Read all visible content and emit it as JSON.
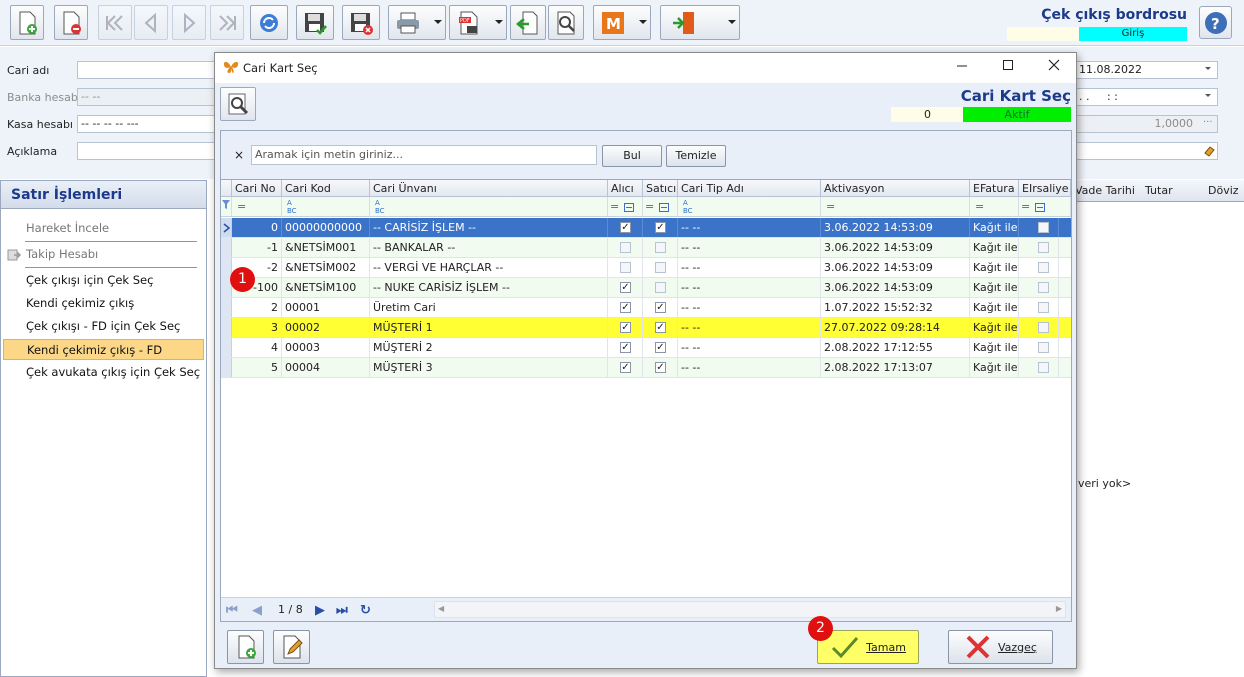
{
  "window": {
    "title": "Çek çıkış bordrosu",
    "status": "Giriş"
  },
  "form": {
    "cari_adi_label": "Cari adı",
    "banka_label": "Banka hesabı",
    "banka_value": "-- --",
    "kasa_label": "Kasa hesabı",
    "kasa_value": "-- -- -- -- ---",
    "aciklama_label": "Açıklama",
    "date_value": "11.08.2022",
    "time_value": ". .     : :",
    "rate_value": "1,0000"
  },
  "sidebar": {
    "title": "Satır İşlemleri",
    "items": [
      {
        "label": "Hareket İncele",
        "state": "disabled"
      },
      {
        "label": "Takip Hesabı",
        "state": "disabled"
      },
      {
        "label": "Çek çıkışı için Çek Seç",
        "state": "normal"
      },
      {
        "label": "Kendi çekimiz çıkış",
        "state": "normal"
      },
      {
        "label": "Çek çıkışı - FD için Çek Seç",
        "state": "normal"
      },
      {
        "label": "Kendi çekimiz çıkış - FD",
        "state": "selected"
      },
      {
        "label": "Çek avukata çıkış için Çek Seç",
        "state": "normal"
      }
    ]
  },
  "right_grid": {
    "columns": [
      "Vade Tarihi",
      "Tutar",
      "Döviz"
    ],
    "empty_text": "veri yok>"
  },
  "dialog": {
    "title": "Cari Kart Seç",
    "header_title": "Cari Kart Seç",
    "count": "0",
    "status": "Aktif",
    "search": {
      "clear": "×",
      "placeholder": "Aramak için metin giriniz...",
      "find_label": "Bul",
      "clear_label": "Temizle"
    },
    "columns": [
      "Cari No",
      "Cari Kod",
      "Cari Ünvanı",
      "Alıcı",
      "Satıcı",
      "Cari Tip Adı",
      "Aktivasyon",
      "EFatura",
      "EIrsaliye"
    ],
    "rows": [
      {
        "no": "0",
        "kod": "00000000000",
        "unvan": "-- CARİSİZ İŞLEM --",
        "alici": true,
        "satici": true,
        "tip": "-- --",
        "aktivasyon": "3.06.2022 14:53:09",
        "efatura": "Kağıt iletim",
        "eirsaliye": false
      },
      {
        "no": "-1",
        "kod": "&NETSİM001",
        "unvan": "-- BANKALAR --",
        "alici": false,
        "satici": false,
        "tip": "-- --",
        "aktivasyon": "3.06.2022 14:53:09",
        "efatura": "Kağıt iletim",
        "eirsaliye": false
      },
      {
        "no": "-2",
        "kod": "&NETSİM002",
        "unvan": "-- VERGİ VE HARÇLAR --",
        "alici": false,
        "satici": false,
        "tip": "-- --",
        "aktivasyon": "3.06.2022 14:53:09",
        "efatura": "Kağıt iletim",
        "eirsaliye": false
      },
      {
        "no": "-100",
        "kod": "&NETSİM100",
        "unvan": "-- NUKE CARİSİZ İŞLEM --",
        "alici": true,
        "satici": false,
        "tip": "-- --",
        "aktivasyon": "3.06.2022 14:53:09",
        "efatura": "Kağıt iletim",
        "eirsaliye": false
      },
      {
        "no": "2",
        "kod": "00001",
        "unvan": "Üretim Cari",
        "alici": true,
        "satici": true,
        "tip": "-- --",
        "aktivasyon": "1.07.2022 15:52:32",
        "efatura": "Kağıt iletim",
        "eirsaliye": false
      },
      {
        "no": "3",
        "kod": "00002",
        "unvan": "MÜŞTERİ 1",
        "alici": true,
        "satici": true,
        "tip": "-- --",
        "aktivasyon": "27.07.2022 09:28:14",
        "efatura": "Kağıt iletim",
        "eirsaliye": false
      },
      {
        "no": "4",
        "kod": "00003",
        "unvan": "MÜŞTERİ 2",
        "alici": true,
        "satici": true,
        "tip": "-- --",
        "aktivasyon": "2.08.2022 17:12:55",
        "efatura": "Kağıt iletim",
        "eirsaliye": false
      },
      {
        "no": "5",
        "kod": "00004",
        "unvan": "MÜŞTERİ 3",
        "alici": true,
        "satici": true,
        "tip": "-- --",
        "aktivasyon": "2.08.2022 17:13:07",
        "efatura": "Kağıt iletim",
        "eirsaliye": false
      }
    ],
    "pager": "1 / 8",
    "ok_label": "Tamam",
    "cancel_label": "Vazgeç",
    "markers": [
      "1",
      "2"
    ]
  },
  "colors": {
    "selected_row": "#3b73c8",
    "highlight_row": "#ffff33",
    "accent_title": "#1d3a8a",
    "aktif": "#00ee00",
    "giris": "#00ffff",
    "marker": "#e01010"
  }
}
